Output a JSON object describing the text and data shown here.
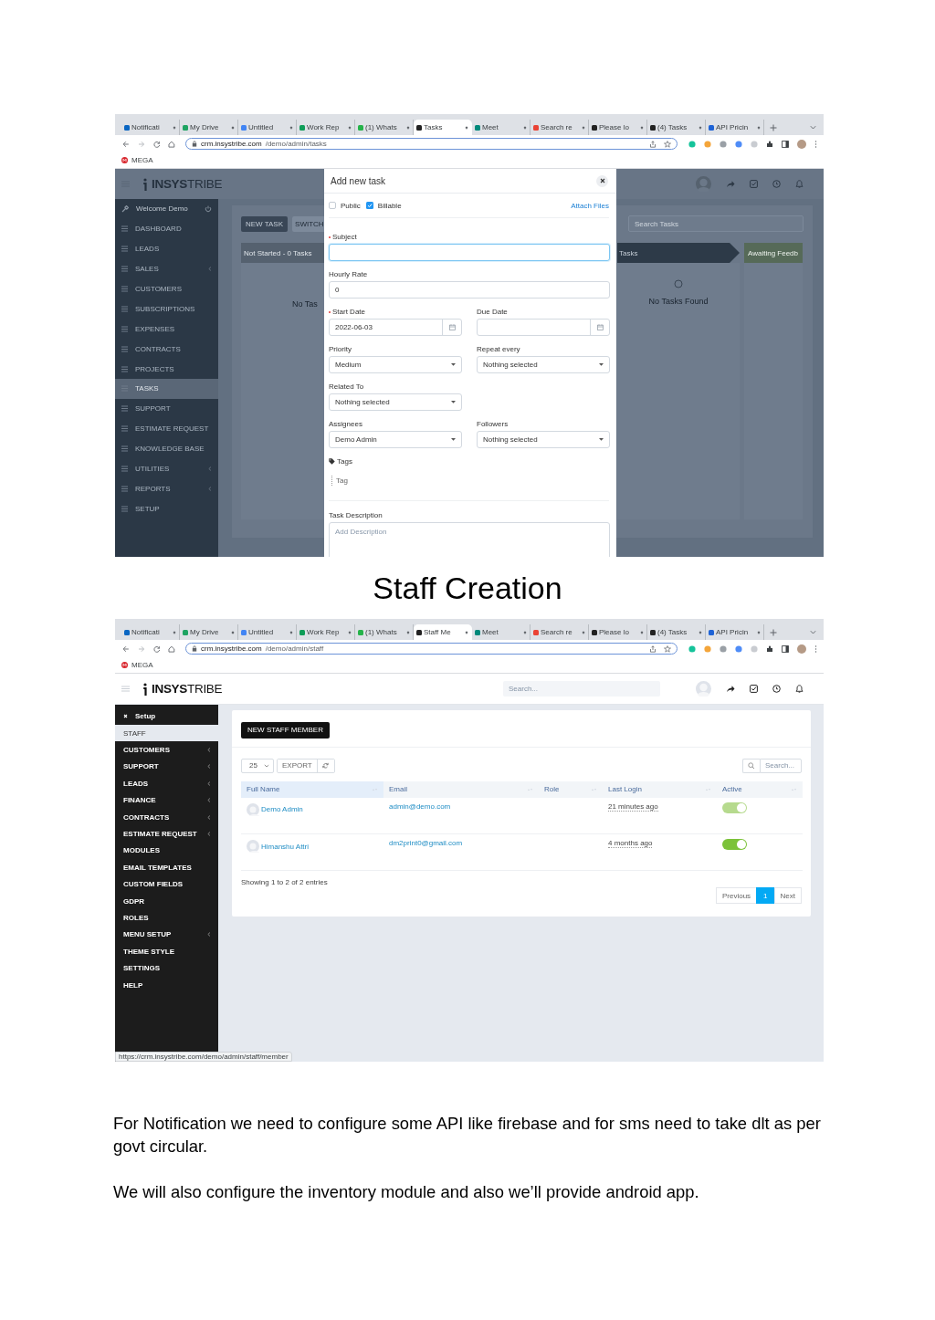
{
  "tasks_screenshot": {
    "browser": {
      "tabs": [
        {
          "label": "Notificati",
          "selected": false,
          "color": "#0a66c2"
        },
        {
          "label": "My Drive",
          "selected": false,
          "color": "#1fa463"
        },
        {
          "label": "Untitled",
          "selected": false,
          "color": "#4285f4"
        },
        {
          "label": "Work Rep",
          "selected": false,
          "color": "#0f9d58"
        },
        {
          "label": "(1) Whats",
          "selected": false,
          "color": "#25b34a"
        },
        {
          "label": "Tasks",
          "selected": true,
          "color": "#222222"
        },
        {
          "label": "Meet",
          "selected": false,
          "color": "#00897b"
        },
        {
          "label": "Search re",
          "selected": false,
          "color": "#ea4335"
        },
        {
          "label": "Please lo",
          "selected": false,
          "color": "#222222"
        },
        {
          "label": "(4) Tasks",
          "selected": false,
          "color": "#222222"
        },
        {
          "label": "API Pricin",
          "selected": false,
          "color": "#1e63d6"
        }
      ],
      "address": {
        "host": "crm.insystribe.com",
        "path": "/demo/admin/tasks"
      },
      "bookmarks": [
        "MEGA"
      ]
    },
    "app": {
      "logo": "**INSYS**TRIBE",
      "welcome": "Welcome Demo",
      "menu": [
        {
          "label": "DASHBOARD",
          "selected": false,
          "has_submenu": false
        },
        {
          "label": "LEADS",
          "selected": false,
          "has_submenu": false
        },
        {
          "label": "SALES",
          "selected": false,
          "has_submenu": true
        },
        {
          "label": "CUSTOMERS",
          "selected": false,
          "has_submenu": false
        },
        {
          "label": "SUBSCRIPTIONS",
          "selected": false,
          "has_submenu": false
        },
        {
          "label": "EXPENSES",
          "selected": false,
          "has_submenu": false
        },
        {
          "label": "CONTRACTS",
          "selected": false,
          "has_submenu": false
        },
        {
          "label": "PROJECTS",
          "selected": false,
          "has_submenu": false
        },
        {
          "label": "TASKS",
          "selected": true,
          "has_submenu": false
        },
        {
          "label": "SUPPORT",
          "selected": false,
          "has_submenu": false
        },
        {
          "label": "ESTIMATE REQUEST",
          "selected": false,
          "has_submenu": false
        },
        {
          "label": "KNOWLEDGE BASE",
          "selected": false,
          "has_submenu": false
        },
        {
          "label": "UTILITIES",
          "selected": false,
          "has_submenu": true
        },
        {
          "label": "REPORTS",
          "selected": false,
          "has_submenu": true
        },
        {
          "label": "SETUP",
          "selected": false,
          "has_submenu": false
        }
      ],
      "buttons": [
        "NEW TASK",
        "SWITCH"
      ],
      "search_placeholder": "Search Tasks",
      "columns": [
        {
          "kind": "plain",
          "title": "Not Started - 0 Tasks",
          "empty_text": "No Tas",
          "spinner": false
        },
        {
          "kind": "arrow",
          "title": "Tasks",
          "empty_text": "No Tasks Found",
          "spinner": true
        },
        {
          "kind": "green",
          "title": "Awaiting Feedb",
          "spinner": false
        }
      ]
    },
    "modal": {
      "title": "Add new task",
      "options": [
        {
          "label": "Public",
          "checked": false
        },
        {
          "label": "Billable",
          "checked": true
        }
      ],
      "attach_link": "Attach Files",
      "rows": [
        {
          "fields": [
            {
              "kind": "text",
              "label": "Subject",
              "required": true,
              "focused": true
            }
          ]
        },
        {
          "fields": [
            {
              "kind": "text",
              "label": "Hourly Rate",
              "required": false,
              "focused": false,
              "value": "0"
            }
          ]
        },
        {
          "fields": [
            {
              "kind": "date",
              "label": "Start Date",
              "required": true,
              "focused": false,
              "value": "2022-06-03"
            },
            {
              "kind": "date",
              "label": "Due Date",
              "required": false,
              "focused": false
            }
          ]
        },
        {
          "fields": [
            {
              "kind": "select",
              "label": "Priority",
              "required": false,
              "focused": false,
              "value": "Medium"
            },
            {
              "kind": "select",
              "label": "Repeat every",
              "required": false,
              "focused": false,
              "value": "Nothing selected"
            }
          ]
        },
        {
          "fields": [
            {
              "kind": "select",
              "label": "Related To",
              "required": false,
              "focused": false,
              "value": "Nothing selected"
            }
          ]
        },
        {
          "fields": [
            {
              "kind": "select",
              "label": "Assignees",
              "required": false,
              "focused": false,
              "value": "Demo Admin"
            },
            {
              "kind": "select",
              "label": "Followers",
              "required": false,
              "focused": false,
              "value": "Nothing selected"
            }
          ]
        },
        {
          "fields": [
            {
              "kind": "tags",
              "label": "Tags",
              "required": false,
              "focused": false,
              "placeholder": "Tag"
            }
          ]
        },
        {
          "fields": [
            {
              "kind": "textarea",
              "label": "Task Description",
              "required": false,
              "focused": false,
              "placeholder": "Add Description"
            }
          ]
        }
      ]
    }
  },
  "section_heading": "Staff Creation",
  "staff_screenshot": {
    "browser": {
      "tabs": [
        {
          "label": "Notificati",
          "selected": false,
          "color": "#0a66c2"
        },
        {
          "label": "My Drive",
          "selected": false,
          "color": "#1fa463"
        },
        {
          "label": "Untitled",
          "selected": false,
          "color": "#4285f4"
        },
        {
          "label": "Work Rep",
          "selected": false,
          "color": "#0f9d58"
        },
        {
          "label": "(1) Whats",
          "selected": false,
          "color": "#25b34a"
        },
        {
          "label": "Staff Me",
          "selected": true,
          "color": "#222222"
        },
        {
          "label": "Meet",
          "selected": false,
          "color": "#00897b"
        },
        {
          "label": "Search re",
          "selected": false,
          "color": "#ea4335"
        },
        {
          "label": "Please lo",
          "selected": false,
          "color": "#222222"
        },
        {
          "label": "(4) Tasks",
          "selected": false,
          "color": "#222222"
        },
        {
          "label": "API Pricin",
          "selected": false,
          "color": "#1e63d6"
        }
      ],
      "address": {
        "host": "crm.insystribe.com",
        "path": "/demo/admin/staff"
      },
      "bookmarks": [
        "MEGA"
      ],
      "status_url": "https://crm.insystribe.com/demo/admin/staff/member"
    },
    "app": {
      "logo": "**INSYS**TRIBE",
      "search_placeholder": "Search...",
      "sidebar_title": "Setup",
      "menu": [
        {
          "label": "STAFF",
          "selected": true,
          "has_submenu": false
        },
        {
          "label": "CUSTOMERS",
          "selected": false,
          "has_submenu": true
        },
        {
          "label": "SUPPORT",
          "selected": false,
          "has_submenu": true
        },
        {
          "label": "LEADS",
          "selected": false,
          "has_submenu": true
        },
        {
          "label": "FINANCE",
          "selected": false,
          "has_submenu": true
        },
        {
          "label": "CONTRACTS",
          "selected": false,
          "has_submenu": true
        },
        {
          "label": "ESTIMATE REQUEST",
          "selected": false,
          "has_submenu": true
        },
        {
          "label": "MODULES",
          "selected": false,
          "has_submenu": false
        },
        {
          "label": "EMAIL TEMPLATES",
          "selected": false,
          "has_submenu": false
        },
        {
          "label": "CUSTOM FIELDS",
          "selected": false,
          "has_submenu": false
        },
        {
          "label": "GDPR",
          "selected": false,
          "has_submenu": false
        },
        {
          "label": "ROLES",
          "selected": false,
          "has_submenu": false
        },
        {
          "label": "MENU SETUP",
          "selected": false,
          "has_submenu": true
        },
        {
          "label": "THEME STYLE",
          "selected": false,
          "has_submenu": false
        },
        {
          "label": "SETTINGS",
          "selected": false,
          "has_submenu": false
        },
        {
          "label": "HELP",
          "selected": false,
          "has_submenu": false
        }
      ],
      "new_button": "NEW STAFF MEMBER",
      "page_size": "25",
      "export_button": "EXPORT",
      "table_search_placeholder": "Search...",
      "table": {
        "columns": [
          "Full Name",
          "Email",
          "Role",
          "Last Login",
          "Active"
        ],
        "rows": [
          {
            "name": "Demo Admin",
            "email": "admin@demo.com",
            "last_login": "21 minutes ago",
            "active": true,
            "disabled": true
          },
          {
            "name": "Himanshu Attri",
            "email": "dm2print0@gmail.com",
            "last_login": "4 months ago",
            "active": true,
            "disabled": false
          }
        ]
      },
      "info": "Showing 1 to 2 of 2 entries",
      "pagination": [
        {
          "label": "Previous",
          "selected": false
        },
        {
          "label": "1",
          "selected": true
        },
        {
          "label": "Next",
          "selected": false
        }
      ]
    }
  },
  "paragraphs": [
    "For Notification we need to configure some API like firebase and for sms need to take dlt as per govt circular.",
    "We will also configure the inventory module and also we’ll provide android app."
  ]
}
